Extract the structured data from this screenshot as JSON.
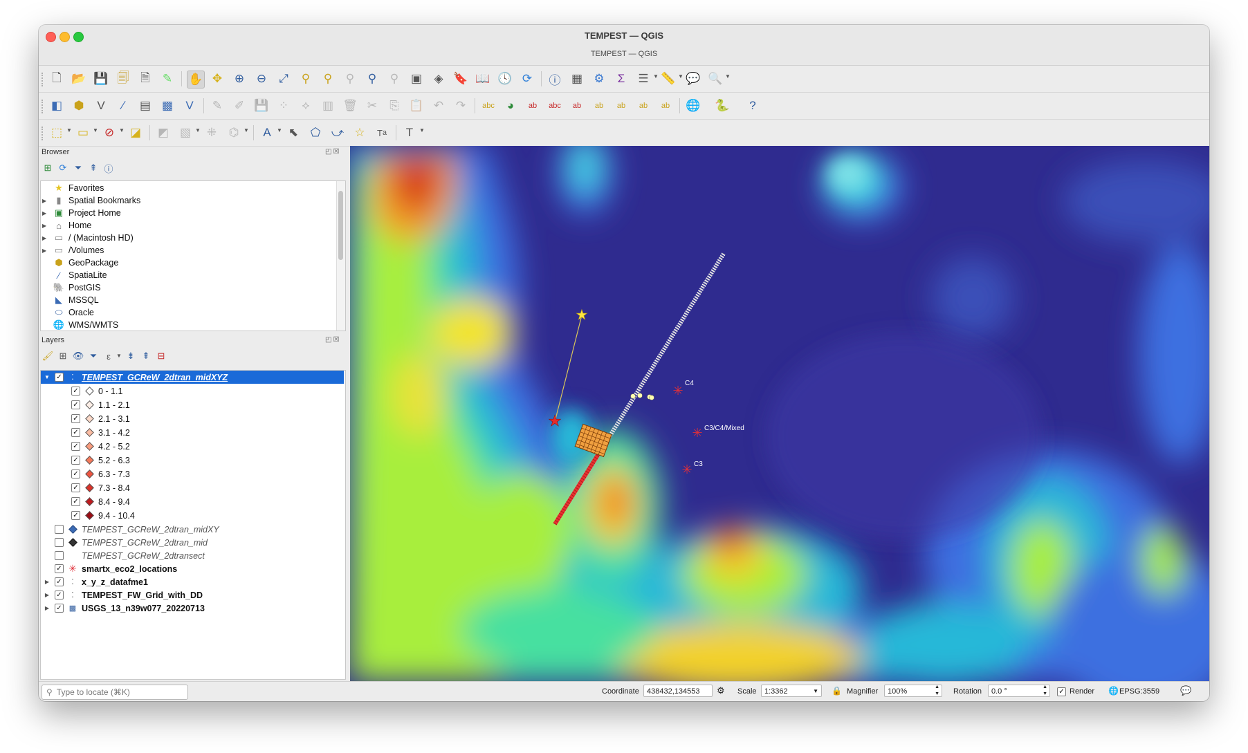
{
  "window": {
    "title": "TEMPEST — QGIS",
    "subtitle": "TEMPEST — QGIS"
  },
  "browser": {
    "title": "Browser",
    "items": [
      {
        "label": "Favorites",
        "icon": "star-icon",
        "expandable": false
      },
      {
        "label": "Spatial Bookmarks",
        "icon": "bookmark-icon",
        "expandable": true
      },
      {
        "label": "Project Home",
        "icon": "project-home-icon",
        "expandable": true
      },
      {
        "label": "Home",
        "icon": "home-folder-icon",
        "expandable": true
      },
      {
        "label": "/ (Macintosh HD)",
        "icon": "folder-icon",
        "expandable": true
      },
      {
        "label": "/Volumes",
        "icon": "folder-icon",
        "expandable": true
      },
      {
        "label": "GeoPackage",
        "icon": "geopackage-icon",
        "expandable": false
      },
      {
        "label": "SpatiaLite",
        "icon": "spatialite-icon",
        "expandable": false
      },
      {
        "label": "PostGIS",
        "icon": "postgis-icon",
        "expandable": false
      },
      {
        "label": "MSSQL",
        "icon": "mssql-icon",
        "expandable": false
      },
      {
        "label": "Oracle",
        "icon": "oracle-icon",
        "expandable": false
      },
      {
        "label": "WMS/WMTS",
        "icon": "wms-icon",
        "expandable": false
      }
    ]
  },
  "layers": {
    "title": "Layers",
    "selected_layer": "TEMPEST_GCReW_2dtran_midXYZ",
    "classes": [
      {
        "label": "0 - 1.1",
        "color": "#ffffff"
      },
      {
        "label": "1.1 - 2.1",
        "color": "#fdeee6"
      },
      {
        "label": "2.1 - 3.1",
        "color": "#fcd9c8"
      },
      {
        "label": "3.1 - 4.2",
        "color": "#fbbca3"
      },
      {
        "label": "4.2 - 5.2",
        "color": "#f99c7e"
      },
      {
        "label": "5.2 - 6.3",
        "color": "#f5795b"
      },
      {
        "label": "6.3 - 7.3",
        "color": "#ec5440"
      },
      {
        "label": "7.3 - 8.4",
        "color": "#d93229"
      },
      {
        "label": "8.4 - 9.4",
        "color": "#bf1a1e"
      },
      {
        "label": "9.4 - 10.4",
        "color": "#9a0c14"
      }
    ],
    "others": [
      {
        "label": "TEMPEST_GCReW_2dtran_midXY",
        "checked": false
      },
      {
        "label": "TEMPEST_GCReW_2dtran_mid",
        "checked": false
      },
      {
        "label": "TEMPEST_GCReW_2dtransect",
        "checked": false
      },
      {
        "label": "smartx_eco2_locations",
        "checked": true
      },
      {
        "label": "x_y_z_datafme1",
        "checked": true
      },
      {
        "label": "TEMPEST_FW_Grid_with_DD",
        "checked": true
      },
      {
        "label": "USGS_13_n39w077_20220713",
        "checked": true
      }
    ]
  },
  "map": {
    "labels": {
      "c4": "C4",
      "c3c4": "C3/C4/Mixed",
      "c3": "C3"
    },
    "colors": {
      "water": "#2f2b8f",
      "high": "#e0441b",
      "star_red": "#e52b2b",
      "star_yellow": "#ffe640"
    }
  },
  "statusbar": {
    "locate_placeholder": "Type to locate (⌘K)",
    "coordinate_label": "Coordinate",
    "coordinate_value": "438432,134553",
    "scale_label": "Scale",
    "scale_value": "1:3362",
    "magnifier_label": "Magnifier",
    "magnifier_value": "100%",
    "rotation_label": "Rotation",
    "rotation_value": "0.0 °",
    "render_label": "Render",
    "crs": "EPSG:3559"
  }
}
